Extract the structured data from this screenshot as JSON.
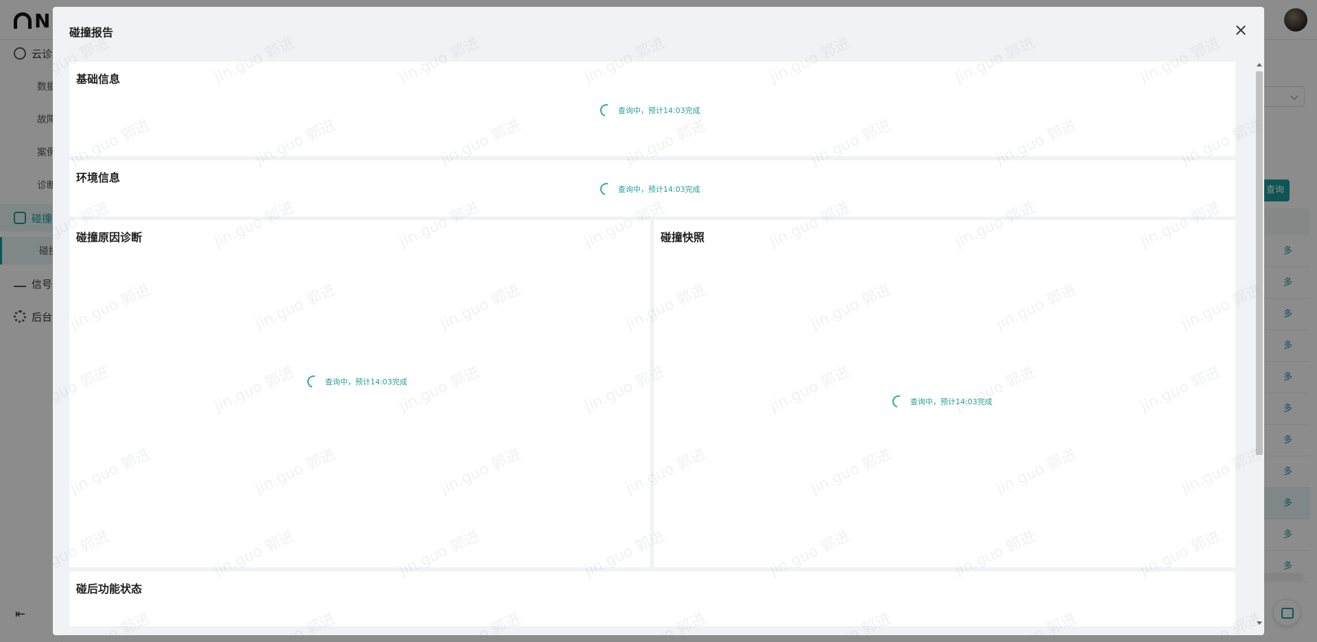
{
  "background": {
    "logo_text": "N",
    "nav_items": [
      "云诊",
      "数据",
      "故障",
      "案例",
      "诊断",
      "碰撞",
      "碰撞",
      "信号",
      "后台"
    ],
    "table_link": "多",
    "query_button": "查询"
  },
  "modal": {
    "title": "碰撞报告",
    "close_icon": "close-icon",
    "sections": {
      "basic_info": {
        "title": "基础信息",
        "loading_text": "查询中，预计14:03完成"
      },
      "env_info": {
        "title": "环境信息",
        "loading_text": "查询中，预计14:03完成"
      },
      "cause_diagnosis": {
        "title": "碰撞原因诊断",
        "loading_text": "查询中，预计14:03完成"
      },
      "snapshot": {
        "title": "碰撞快照",
        "loading_text": "查询中，预计14:03完成"
      },
      "post_function": {
        "title": "碰后功能状态"
      }
    }
  },
  "watermark": {
    "text": "jin.guo 郭进"
  },
  "colors": {
    "accent": "#1a9b9b",
    "loading_text": "#2a9c9c",
    "modal_bg": "#f0f2f5"
  }
}
